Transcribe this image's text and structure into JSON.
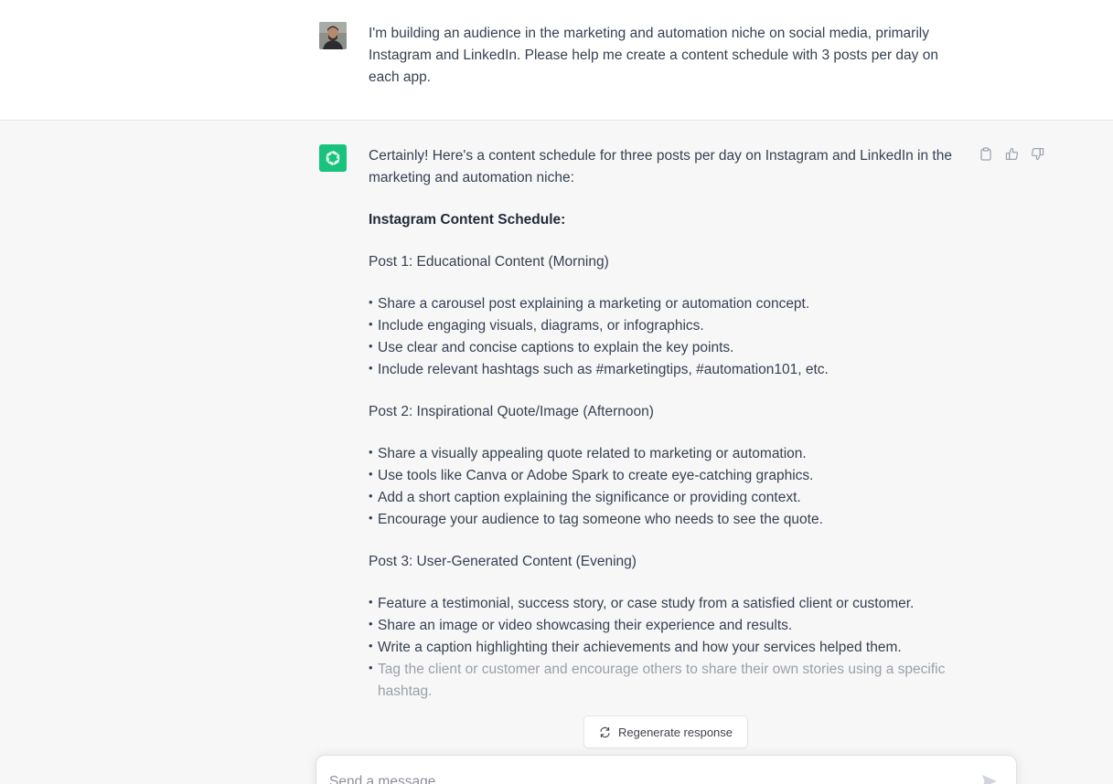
{
  "user_message": {
    "text": "I'm building an audience in the marketing and automation niche on social media, primarily Instagram and LinkedIn. Please help me create a content schedule with 3 posts per day on each app."
  },
  "assistant_message": {
    "intro": "Certainly! Here's a content schedule for three posts per day on Instagram and LinkedIn in the marketing and automation niche:",
    "heading": "Instagram Content Schedule:",
    "posts": [
      {
        "title": "Post 1: Educational Content (Morning)",
        "bullets": [
          "Share a carousel post explaining a marketing or automation concept.",
          "Include engaging visuals, diagrams, or infographics.",
          "Use clear and concise captions to explain the key points.",
          "Include relevant hashtags such as #marketingtips, #automation101, etc."
        ]
      },
      {
        "title": "Post 2: Inspirational Quote/Image (Afternoon)",
        "bullets": [
          "Share a visually appealing quote related to marketing or automation.",
          "Use tools like Canva or Adobe Spark to create eye-catching graphics.",
          "Add a short caption explaining the significance or providing context.",
          "Encourage your audience to tag someone who needs to see the quote."
        ]
      },
      {
        "title": "Post 3: User-Generated Content (Evening)",
        "bullets": [
          "Feature a testimonial, success story, or case study from a satisfied client or customer.",
          "Share an image or video showcasing their experience and results.",
          "Write a caption highlighting their achievements and how your services helped them.",
          "Tag the client or customer and encourage others to share their own stories using a specific hashtag."
        ]
      }
    ]
  },
  "actions": {
    "copy_icon": "clipboard-icon",
    "like_icon": "thumbs-up-icon",
    "dislike_icon": "thumbs-down-icon"
  },
  "regenerate": {
    "label": "Regenerate response"
  },
  "composer": {
    "placeholder": "Send a message"
  },
  "colors": {
    "accent": "#19c37d",
    "assistant_bg": "#f7f7f8",
    "text": "#374151"
  }
}
